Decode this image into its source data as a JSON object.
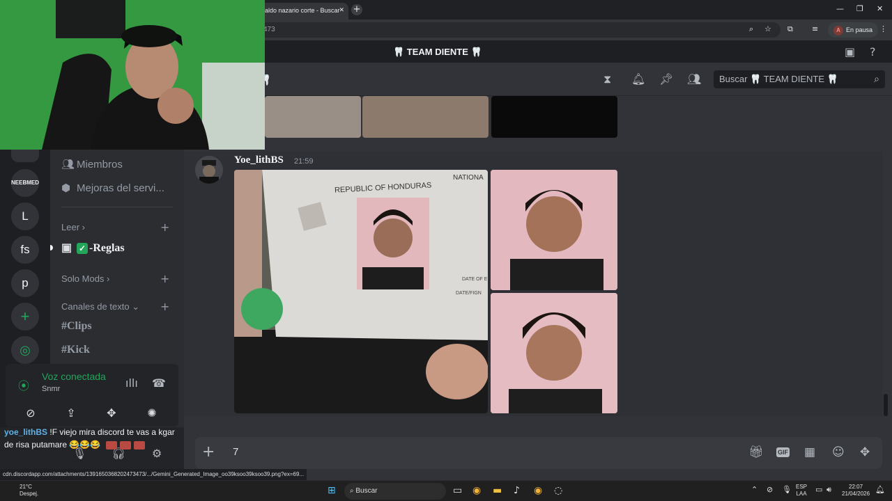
{
  "browser": {
    "tab_title": "aldo nazario corte - Buscar",
    "url_fragment": "473",
    "pause_label": "En pausa",
    "pause_avatar": "A"
  },
  "server": {
    "name": "🦷 TEAM DIENTE 🦷",
    "channel_fragment": "al 🦷",
    "search_placeholder": "Buscar 🦷 TEAM DIENTE 🦷"
  },
  "guilds": [
    "NEEBMED",
    "L",
    "fs",
    "p"
  ],
  "sidebar": {
    "members": "Miembros",
    "boosts": "Mejoras del servi...",
    "cat_read": "Leer",
    "rules": "-Reglas",
    "cat_mods": "Solo Mods",
    "cat_text": "Canales de texto",
    "ch_clips": "Clips",
    "ch_kick": "Kick"
  },
  "voice": {
    "status": "Voz conectada",
    "channel": "Snmr"
  },
  "stream_chat": {
    "user": "yoe_lithBS",
    "text": "!F viejo mira discord te vas a kgar de risa putamare 😂😂😂"
  },
  "message": {
    "author": "Yoe_lithBS",
    "time": "21:59",
    "id_card_header": "REPUBLIC OF HONDURAS",
    "id_card_right": "NATIONA",
    "id_card_date1": "DATE OF E",
    "id_card_date2": "DATE/FIGN"
  },
  "composer": {
    "text": "7"
  },
  "status_url": "cdn.discordapp.com/attachments/1391650368202473473/.../Gemini_Generated_Image_oo39ksoo39ksoo39.png?ex=69...",
  "taskbar": {
    "search": "Buscar",
    "weather_temp": "21°C",
    "weather_desc": "Despej.",
    "lang": "ESP",
    "lang2": "LAA",
    "time": "22:07",
    "date": "21/04/2026"
  },
  "colors": {
    "discord_bg": "#313338",
    "sidebar_bg": "#2b2d31",
    "guild_bg": "#1e1f22",
    "voice_green": "#23a55a"
  }
}
